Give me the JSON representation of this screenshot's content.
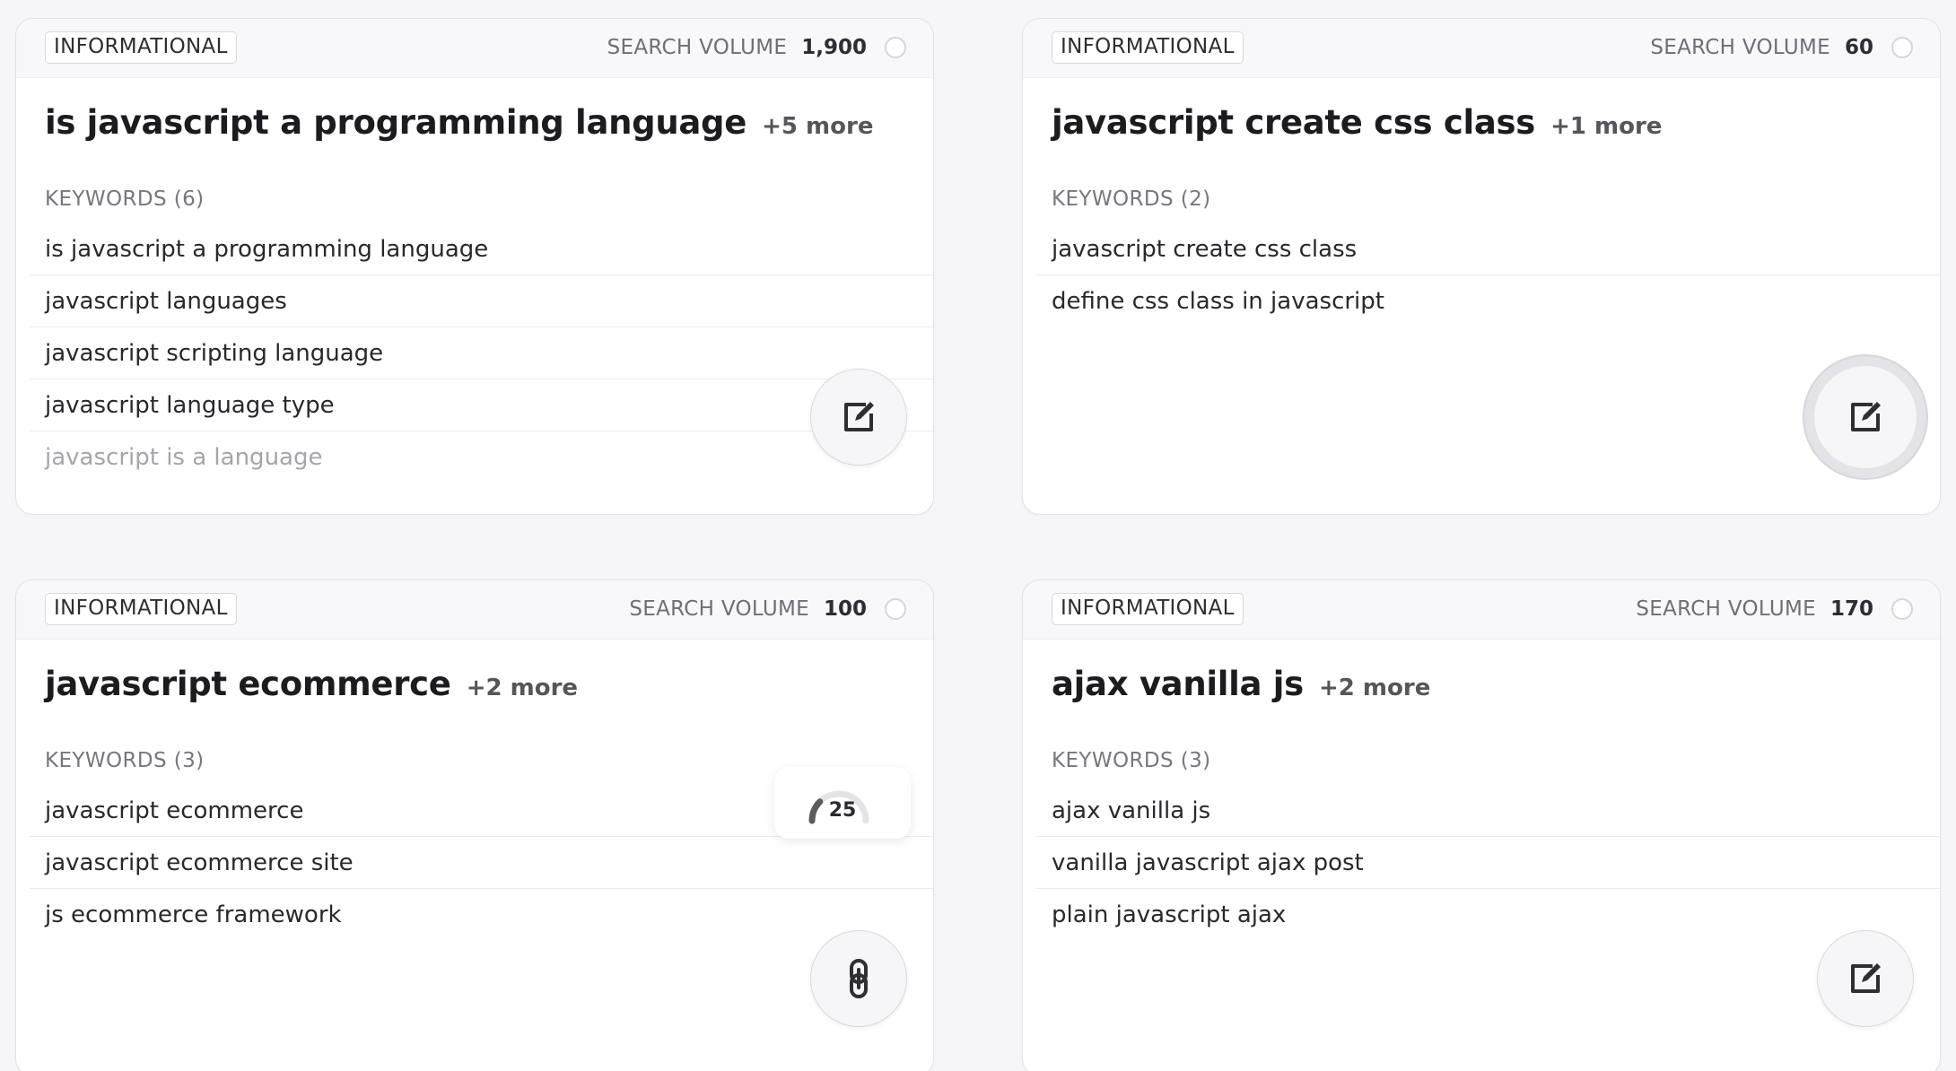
{
  "colors": {
    "background": "#f6f6f9",
    "card": "#ffffff",
    "header": "#f8f8fa",
    "text": "#1f1f23",
    "muted": "#77777e",
    "faded_text": "#a5a5ac",
    "score_arc": "#5a5a60",
    "score_track": "#e4e4e8"
  },
  "cards": [
    {
      "intent": "INFORMATIONAL",
      "volume_label": "SEARCH VOLUME",
      "volume": "1,900",
      "main_keyword": "is javascript a programming language",
      "more": "+5 more",
      "keywords_heading": "KEYWORDS (6)",
      "keywords": [
        "is javascript a programming language",
        "javascript languages",
        "javascript scripting language",
        "javascript language type",
        "javascript is a language"
      ],
      "action_icon": "edit-icon"
    },
    {
      "intent": "INFORMATIONAL",
      "volume_label": "SEARCH VOLUME",
      "volume": "60",
      "main_keyword": "javascript create css class",
      "more": "+1 more",
      "keywords_heading": "KEYWORDS (2)",
      "keywords": [
        "javascript create css class",
        "define css class in javascript"
      ],
      "action_icon": "edit-icon"
    },
    {
      "intent": "INFORMATIONAL",
      "volume_label": "SEARCH VOLUME",
      "volume": "100",
      "main_keyword": "javascript ecommerce",
      "more": "+2 more",
      "keywords_heading": "KEYWORDS (3)",
      "keywords": [
        "javascript ecommerce",
        "javascript ecommerce site",
        "js ecommerce framework"
      ],
      "score": {
        "value": "25",
        "level": 0.25
      },
      "action_icon": "link-icon"
    },
    {
      "intent": "INFORMATIONAL",
      "volume_label": "SEARCH VOLUME",
      "volume": "170",
      "main_keyword": "ajax vanilla js",
      "more": "+2 more",
      "keywords_heading": "KEYWORDS (3)",
      "keywords": [
        "ajax vanilla js",
        "vanilla javascript ajax post",
        "plain javascript ajax"
      ],
      "action_icon": "edit-icon"
    }
  ]
}
